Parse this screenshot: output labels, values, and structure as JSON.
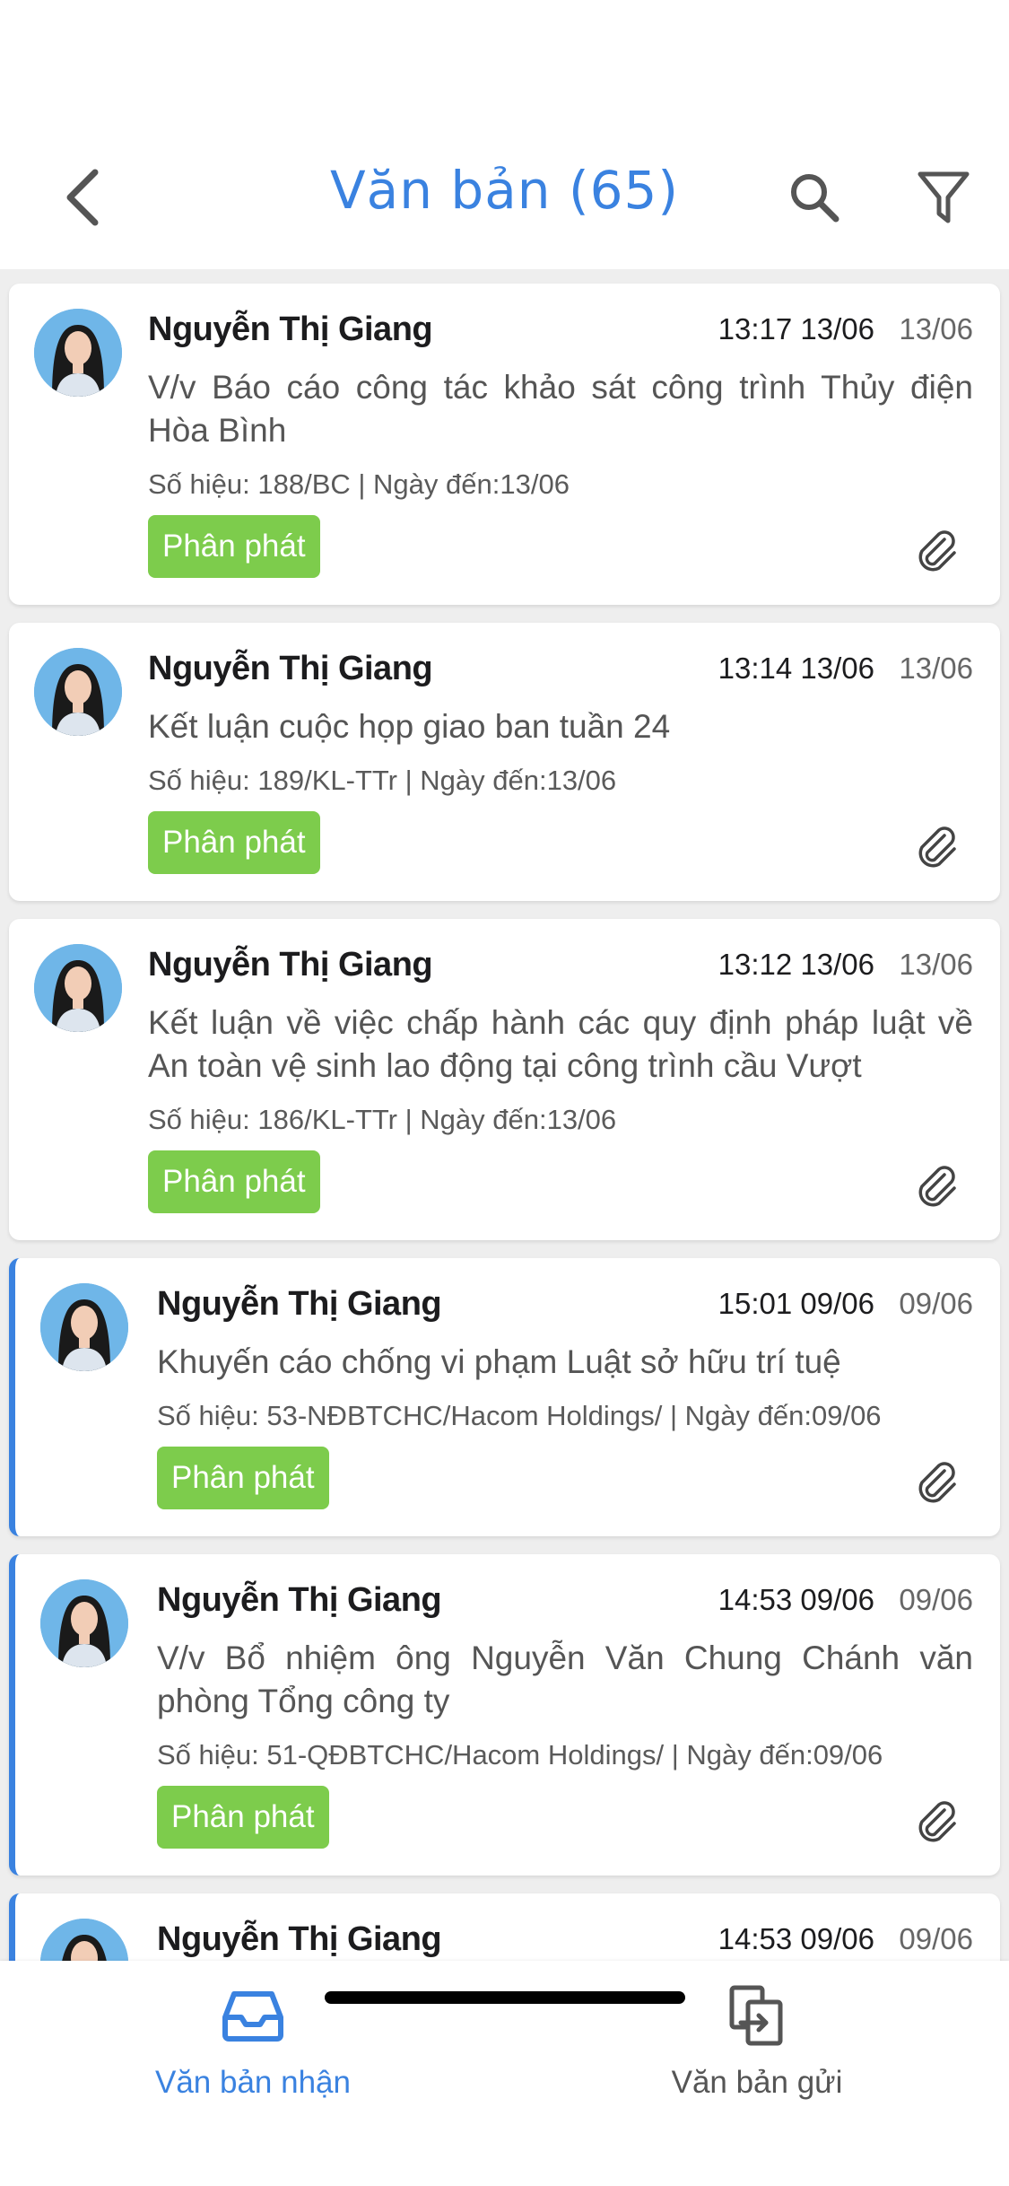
{
  "header": {
    "title": "Văn bản (65)"
  },
  "documents": [
    {
      "sender": "Nguyễn Thị Giang",
      "time": "13:17 13/06",
      "date": "13/06",
      "subject": "V/v Báo cáo công tác khảo sát công trình Thủy điện Hòa Bình",
      "meta": "Số hiệu: 188/BC | Ngày đến:13/06",
      "status": "Phân phát",
      "unread": false
    },
    {
      "sender": "Nguyễn Thị Giang",
      "time": "13:14 13/06",
      "date": "13/06",
      "subject": "Kết luận cuộc họp giao ban tuần 24",
      "meta": "Số hiệu: 189/KL-TTr | Ngày đến:13/06",
      "status": "Phân phát",
      "unread": false
    },
    {
      "sender": "Nguyễn Thị Giang",
      "time": "13:12 13/06",
      "date": "13/06",
      "subject": "Kết luận về việc chấp hành các quy định pháp luật về An toàn vệ sinh lao động tại công trình cầu Vượt",
      "meta": "Số hiệu: 186/KL-TTr | Ngày đến:13/06",
      "status": "Phân phát",
      "unread": false
    },
    {
      "sender": "Nguyễn Thị Giang",
      "time": "15:01 09/06",
      "date": "09/06",
      "subject": "Khuyến cáo chống vi phạm Luật sở hữu trí tuệ",
      "meta": "Số hiệu: 53-NĐBTCHC/Hacom Holdings/ | Ngày đến:09/06",
      "status": "Phân phát",
      "unread": true
    },
    {
      "sender": "Nguyễn Thị Giang",
      "time": "14:53 09/06",
      "date": "09/06",
      "subject": "V/v Bổ nhiệm ông Nguyễn Văn Chung Chánh văn phòng Tổng công ty",
      "meta": "Số hiệu: 51-QĐBTCHC/Hacom Holdings/ | Ngày đến:09/06",
      "status": "Phân phát",
      "unread": true
    },
    {
      "sender": "Nguyễn Thị Giang",
      "time": "14:53 09/06",
      "date": "09/06",
      "unread": true
    }
  ],
  "bottom_nav": {
    "inbox_label": "Văn bản nhận",
    "sent_label": "Văn bản gửi"
  },
  "colors": {
    "accent": "#3a82e0",
    "status_badge": "#7dcc4c",
    "avatar_bg": "#6fb6e8"
  },
  "icons": {
    "back": "chevron-left-icon",
    "search": "search-icon",
    "filter": "filter-icon",
    "attachment": "paperclip-icon",
    "inbox": "inbox-tray-icon",
    "sent": "send-document-icon"
  }
}
